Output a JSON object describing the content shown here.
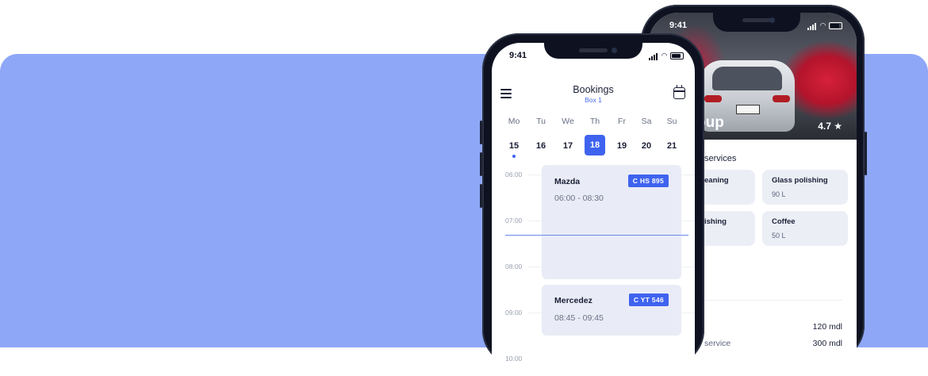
{
  "colors": {
    "banner": "#8ea7f7",
    "accent": "#3f63ef",
    "text": "#1a1f36"
  },
  "back_phone": {
    "status_time": "9:41",
    "hero_title": "oup",
    "rating": "4.7",
    "rating_icon": "star-icon",
    "services_title": "services",
    "services": [
      {
        "name": "eaning",
        "price": ""
      },
      {
        "name": "Glass polishing",
        "price": "90 L"
      },
      {
        "name": "ishing",
        "price": ""
      },
      {
        "name": "Coffee",
        "price": "50 L"
      }
    ],
    "prices": [
      {
        "label": "",
        "value": "120 mdl"
      },
      {
        "label": "service",
        "value": "300 mdl"
      }
    ]
  },
  "front_phone": {
    "status_time": "9:41",
    "header": {
      "title": "Bookings",
      "subtitle": "Box 1",
      "menu_icon": "menu-icon",
      "calendar_icon": "calendar-icon"
    },
    "weekdays": [
      "Mo",
      "Tu",
      "We",
      "Th",
      "Fr",
      "Sa",
      "Su"
    ],
    "dates": [
      "15",
      "16",
      "17",
      "18",
      "19",
      "20",
      "21"
    ],
    "selected_date": "18",
    "marked_date": "15",
    "hours": [
      "06:00",
      "07:00",
      "08:00",
      "09:00",
      "10:00"
    ],
    "bookings": [
      {
        "car": "Mazda",
        "plate": "C HS 895",
        "time": "06:00 - 08:30"
      },
      {
        "car": "Mercedez",
        "plate": "C YT 546",
        "time": "08:45 - 09:45"
      }
    ]
  }
}
